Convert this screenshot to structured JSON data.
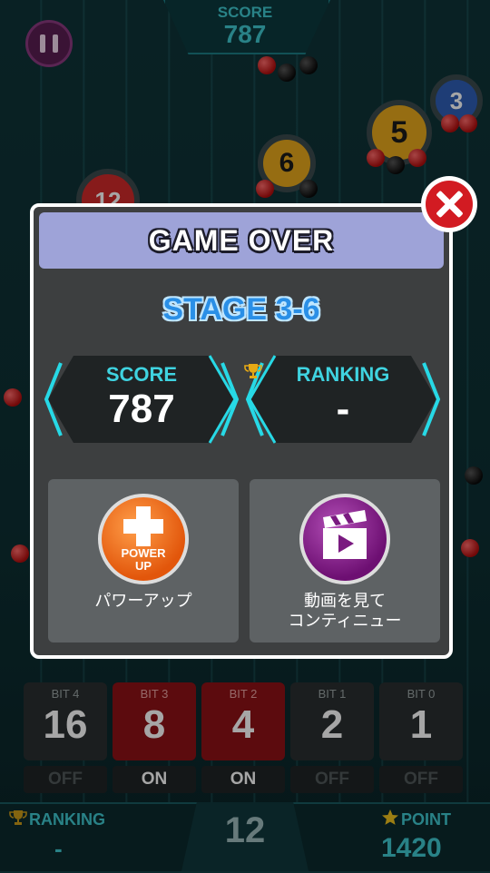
{
  "hud": {
    "score_label": "SCORE",
    "score_value": "787"
  },
  "chips": [
    {
      "label": "5",
      "color": "#e7a81c"
    },
    {
      "label": "6",
      "color": "#e7a81c"
    },
    {
      "label": "3",
      "color": "#2e5fb6"
    },
    {
      "label": "12",
      "color": "#d02a2a"
    }
  ],
  "bits": [
    {
      "label": "BIT 4",
      "value": "16",
      "state": "OFF",
      "on": false
    },
    {
      "label": "BIT 3",
      "value": "8",
      "state": "ON",
      "on": true
    },
    {
      "label": "BIT 2",
      "value": "4",
      "state": "ON",
      "on": true
    },
    {
      "label": "BIT 1",
      "value": "2",
      "state": "OFF",
      "on": false
    },
    {
      "label": "BIT 0",
      "value": "1",
      "state": "OFF",
      "on": false
    }
  ],
  "footer": {
    "ranking_label": "RANKING",
    "ranking_value": "-",
    "center_value": "12",
    "point_label": "POINT",
    "point_value": "1420"
  },
  "dialog": {
    "title": "GAME OVER",
    "stage": "STAGE 3-6",
    "score_label": "SCORE",
    "score_value": "787",
    "ranking_label": "RANKING",
    "ranking_value": "-",
    "power_up_icon_text": "POWER UP",
    "power_up_label": "パワーアップ",
    "continue_label_line1": "動画を見て",
    "continue_label_line2": "コンティニュー"
  },
  "colors": {
    "accent_cyan": "#3fd3e0",
    "stage_blue": "#2a8fe6",
    "bit_on_red": "#8e1216",
    "close_red": "#d21b22"
  }
}
